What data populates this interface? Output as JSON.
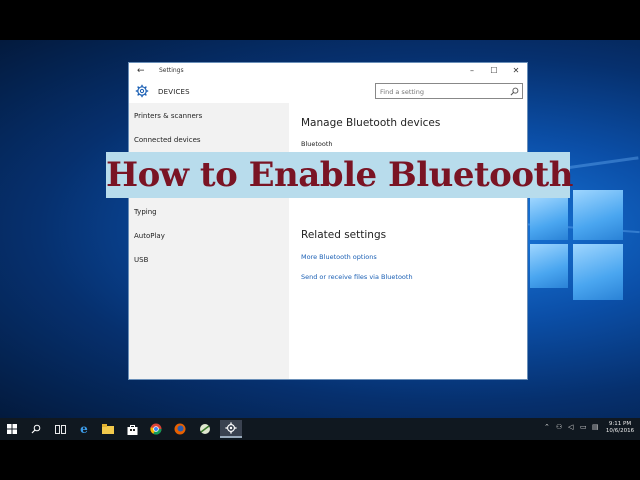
{
  "window": {
    "title": "Settings",
    "header_title": "DEVICES",
    "search_placeholder": "Find a setting",
    "controls": {
      "minimize": "–",
      "maximize": "☐",
      "close": "✕"
    }
  },
  "sidebar": {
    "items": [
      {
        "label": "Printers & scanners"
      },
      {
        "label": "Connected devices"
      },
      {
        "label": "Typing"
      },
      {
        "label": "AutoPlay"
      },
      {
        "label": "USB"
      }
    ]
  },
  "main": {
    "heading": "Manage Bluetooth devices",
    "bluetooth_label": "Bluetooth",
    "related_heading": "Related settings",
    "links": [
      "More Bluetooth options",
      "Send or receive files via Bluetooth"
    ]
  },
  "banner": {
    "text": "How to Enable Bluetooth",
    "text_color": "#7a1424",
    "bg_color": "#b8dcec"
  },
  "taskbar": {
    "icons": [
      "start-icon",
      "search-icon",
      "task-view-icon",
      "edge-icon",
      "file-explorer-icon",
      "store-icon",
      "chrome-icon",
      "firefox-icon",
      "app-icon",
      "settings-icon"
    ],
    "clock_time": "9:11 PM",
    "clock_date": "10/6/2016"
  },
  "colors": {
    "accent": "#1a5fb4",
    "desktop": "#0b4fa8",
    "taskbar": "#101820"
  }
}
